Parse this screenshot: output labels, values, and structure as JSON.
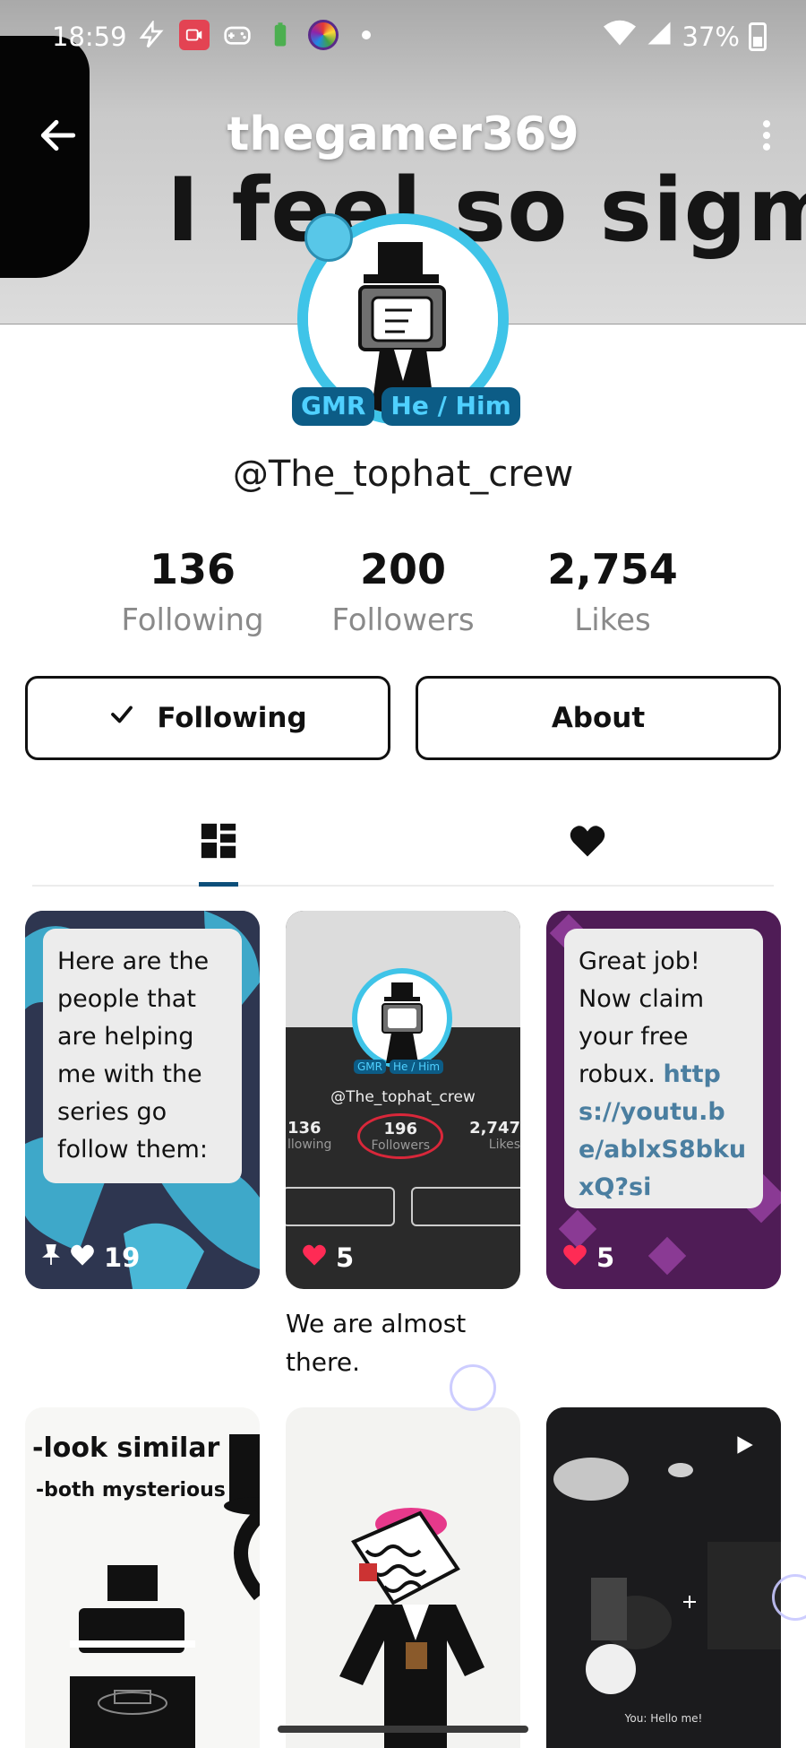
{
  "status_bar": {
    "time": "18:59",
    "battery": "37%",
    "icons": [
      "flash-icon",
      "screen-record-icon",
      "gamepad-icon",
      "battery-saver-icon",
      "game-wheel-icon",
      "dot-icon",
      "wifi-icon",
      "cell-signal-icon",
      "battery-icon"
    ]
  },
  "header": {
    "title": "thegamer369",
    "banner_text": "I feel so sigma"
  },
  "profile": {
    "badges": [
      "GMR",
      "He / Him"
    ],
    "username": "@The_tophat_crew"
  },
  "stats": [
    {
      "value": "136",
      "label": "Following"
    },
    {
      "value": "200",
      "label": "Followers"
    },
    {
      "value": "2,754",
      "label": "Likes"
    }
  ],
  "actions": {
    "following_label": "Following",
    "about_label": "About"
  },
  "tabs": [
    {
      "icon": "grid-icon",
      "selected": true
    },
    {
      "icon": "heart-icon",
      "selected": false
    }
  ],
  "posts": [
    {
      "text": "Here are the people that are helping me with the series go follow them:",
      "likes": "19",
      "pinned": true
    },
    {
      "inner_badges": [
        "GMR",
        "He / Him"
      ],
      "inner_username": "@The_tophat_crew",
      "inner_stats": [
        {
          "value": "136",
          "label": "llowing"
        },
        {
          "value": "196",
          "label": "Followers"
        },
        {
          "value": "2,747",
          "label": "Likes"
        }
      ],
      "likes": "5",
      "caption": "We are almost there."
    },
    {
      "text_plain": "Great job! Now claim your free robux.",
      "text_link": "https://youtu.be/ablxS8bkuxQ?si",
      "likes": "5"
    },
    {
      "line1": "-look similar",
      "line2": "-both mysterious"
    },
    {},
    {
      "overlay_text": "You: Hello me!"
    }
  ],
  "colors": {
    "accent": "#0d4f7a",
    "badge_bg": "#0c5c86",
    "badge_text": "#4fd0ff",
    "like_red": "#ff2b55",
    "link": "#4a7ea0"
  }
}
